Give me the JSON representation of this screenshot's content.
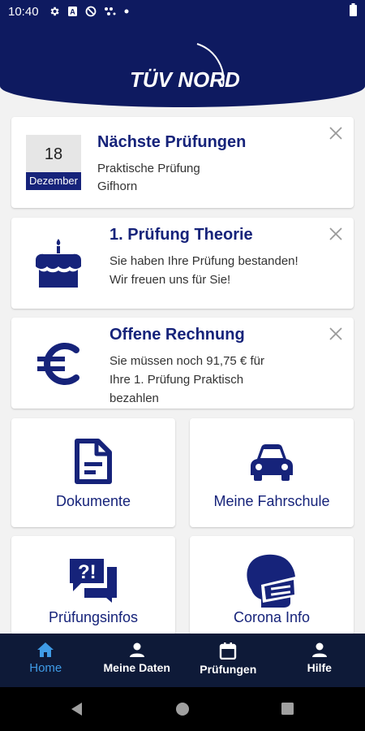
{
  "status_bar": {
    "time": "10:40",
    "icons": [
      "gear-icon",
      "sim-card-icon",
      "no-data-icon",
      "signal-dots-icon",
      "dot-icon",
      "battery-icon"
    ]
  },
  "header": {
    "logo_text": "TÜV NORD",
    "background_color": "#0e1a60"
  },
  "cards": [
    {
      "date_day": "18",
      "date_month": "Dezember",
      "title": "Nächste Prüfungen",
      "line1": "Praktische Prüfung",
      "line2": "Gifhorn",
      "close_icon": "close-icon"
    },
    {
      "icon": "cake-icon",
      "title": "1. Prüfung Theorie",
      "text": "Sie haben Ihre Prüfung bestanden! Wir freuen uns für Sie!",
      "close_icon": "close-icon"
    },
    {
      "icon": "euro-icon",
      "title": "Offene Rechnung",
      "text": "Sie müssen noch 91,75 € für Ihre 1. Prüfung Praktisch bezahlen",
      "close_icon": "close-icon"
    }
  ],
  "tiles": [
    {
      "label": "Dokumente",
      "icon": "document-icon"
    },
    {
      "label": "Meine Fahrschule",
      "icon": "car-icon"
    },
    {
      "label": "Prüfungsinfos",
      "icon": "question-chat-icon"
    },
    {
      "label": "Corona Info",
      "icon": "mask-head-icon"
    }
  ],
  "bottom_nav": {
    "items": [
      {
        "label": "Home",
        "icon": "home-icon",
        "active": true
      },
      {
        "label": "Meine Daten",
        "icon": "person-icon",
        "active": false
      },
      {
        "label": "Prüfungen",
        "icon": "calendar-icon",
        "active": false
      },
      {
        "label": "Hilfe",
        "icon": "person-icon",
        "active": false
      }
    ]
  },
  "colors": {
    "brand_dark": "#0e1a60",
    "title_blue": "#16237a",
    "nav_background": "#0e1a38",
    "nav_active": "#3f9be6"
  }
}
